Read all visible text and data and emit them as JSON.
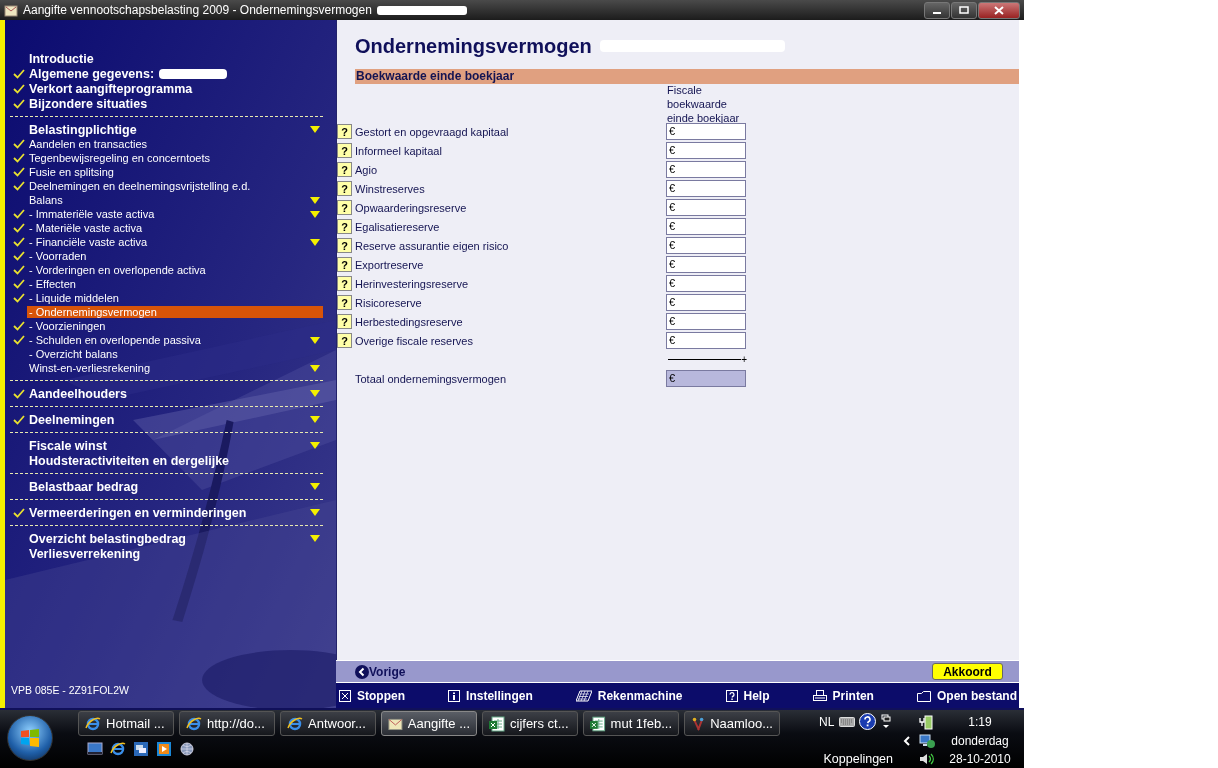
{
  "window": {
    "title": "Aangifte vennootschapsbelasting 2009 - Ondernemingsvermogen"
  },
  "sidebar": {
    "sections": [
      {
        "items": [
          {
            "kind": "heading",
            "label": "Introductie",
            "checked": false,
            "has_menu": false,
            "selected": false
          },
          {
            "kind": "heading",
            "label": "Algemene gegevens:",
            "checked": true,
            "has_menu": false,
            "selected": false
          },
          {
            "kind": "heading",
            "label": "Verkort aangifteprogramma",
            "checked": true,
            "has_menu": false,
            "selected": false
          },
          {
            "kind": "heading",
            "label": "Bijzondere situaties",
            "checked": true,
            "has_menu": false,
            "selected": false
          }
        ]
      },
      {
        "items": [
          {
            "kind": "heading",
            "label": "Belastingplichtige",
            "checked": false,
            "has_menu": true,
            "selected": false
          },
          {
            "kind": "item",
            "label": "Aandelen en transacties",
            "checked": true,
            "has_menu": false,
            "selected": false
          },
          {
            "kind": "item",
            "label": "Tegenbewijsregeling en concerntoets",
            "checked": true,
            "has_menu": false,
            "selected": false
          },
          {
            "kind": "item",
            "label": "Fusie en splitsing",
            "checked": true,
            "has_menu": false,
            "selected": false
          },
          {
            "kind": "item",
            "label": "Deelnemingen en deelnemingsvrijstelling e.d.",
            "checked": true,
            "has_menu": false,
            "selected": false
          },
          {
            "kind": "item",
            "label": "Balans",
            "checked": false,
            "has_menu": true,
            "selected": false
          },
          {
            "kind": "item",
            "label": "- Immateriële vaste activa",
            "checked": true,
            "has_menu": true,
            "selected": false
          },
          {
            "kind": "item",
            "label": "- Materiële vaste activa",
            "checked": true,
            "has_menu": false,
            "selected": false
          },
          {
            "kind": "item",
            "label": "- Financiële vaste activa",
            "checked": true,
            "has_menu": true,
            "selected": false
          },
          {
            "kind": "item",
            "label": "- Voorraden",
            "checked": true,
            "has_menu": false,
            "selected": false
          },
          {
            "kind": "item",
            "label": "- Vorderingen en overlopende activa",
            "checked": true,
            "has_menu": false,
            "selected": false
          },
          {
            "kind": "item",
            "label": "- Effecten",
            "checked": true,
            "has_menu": false,
            "selected": false
          },
          {
            "kind": "item",
            "label": "- Liquide middelen",
            "checked": true,
            "has_menu": false,
            "selected": false
          },
          {
            "kind": "item",
            "label": "- Ondernemingsvermogen",
            "checked": false,
            "has_menu": false,
            "selected": true
          },
          {
            "kind": "item",
            "label": "- Voorzieningen",
            "checked": true,
            "has_menu": false,
            "selected": false
          },
          {
            "kind": "item",
            "label": "- Schulden en overlopende passiva",
            "checked": true,
            "has_menu": true,
            "selected": false
          },
          {
            "kind": "item",
            "label": "- Overzicht balans",
            "checked": false,
            "has_menu": false,
            "selected": false
          },
          {
            "kind": "item",
            "label": "Winst-en-verliesrekening",
            "checked": false,
            "has_menu": true,
            "selected": false
          }
        ]
      },
      {
        "items": [
          {
            "kind": "heading",
            "label": "Aandeelhouders",
            "checked": true,
            "has_menu": true,
            "selected": false
          }
        ]
      },
      {
        "items": [
          {
            "kind": "heading",
            "label": "Deelnemingen",
            "checked": true,
            "has_menu": true,
            "selected": false
          }
        ]
      },
      {
        "items": [
          {
            "kind": "heading",
            "label": "Fiscale winst",
            "checked": false,
            "has_menu": true,
            "selected": false
          },
          {
            "kind": "heading",
            "label": "Houdsteractiviteiten en dergelijke",
            "checked": false,
            "has_menu": false,
            "selected": false
          }
        ]
      },
      {
        "items": [
          {
            "kind": "heading",
            "label": "Belastbaar bedrag",
            "checked": false,
            "has_menu": true,
            "selected": false
          }
        ]
      },
      {
        "items": [
          {
            "kind": "heading",
            "label": "Vermeerderingen en verminderingen",
            "checked": true,
            "has_menu": true,
            "selected": false
          }
        ]
      },
      {
        "items": [
          {
            "kind": "heading",
            "label": "Overzicht belastingbedrag",
            "checked": false,
            "has_menu": true,
            "selected": false
          },
          {
            "kind": "heading",
            "label": "Verliesverrekening",
            "checked": false,
            "has_menu": false,
            "selected": false
          }
        ]
      }
    ],
    "footer": "VPB 085E - 2Z91FOL2W"
  },
  "form": {
    "title": "Ondernemingsvermogen",
    "section": "Boekwaarde einde boekjaar",
    "column_header": "Fiscale boekwaarde einde boekjaar",
    "rows": [
      {
        "help": "?",
        "label": "Gestort en opgevraagd kapitaal",
        "value": "€"
      },
      {
        "help": "?",
        "label": "Informeel kapitaal",
        "value": "€"
      },
      {
        "help": "?",
        "label": "Agio",
        "value": "€"
      },
      {
        "help": "?",
        "label": "Winstreserves",
        "value": "€"
      },
      {
        "help": "?",
        "label": "Opwaarderingsreserve",
        "value": "€"
      },
      {
        "help": "?",
        "label": "Egalisatiereserve",
        "value": "€"
      },
      {
        "help": "?",
        "label": "Reserve assurantie eigen risico",
        "value": "€"
      },
      {
        "help": "?",
        "label": "Exportreserve",
        "value": "€"
      },
      {
        "help": "?",
        "label": "Herinvesteringsreserve",
        "value": "€"
      },
      {
        "help": "?",
        "label": "Risicoreserve",
        "value": "€"
      },
      {
        "help": "?",
        "label": "Herbestedingsreserve",
        "value": "€"
      },
      {
        "help": "?",
        "label": "Overige fiscale reserves",
        "value": "€"
      }
    ],
    "sum_sign": "+",
    "total": {
      "label": "Totaal ondernemingsvermogen",
      "value": "€"
    }
  },
  "action_bar": {
    "back": "Vorige",
    "confirm": "Akkoord"
  },
  "toolbar": [
    {
      "label": "Stoppen"
    },
    {
      "label": "Instellingen"
    },
    {
      "label": "Rekenmachine"
    },
    {
      "label": "Help"
    },
    {
      "label": "Printen"
    },
    {
      "label": "Open bestand"
    }
  ],
  "taskbar": {
    "tasks": [
      {
        "label": "Hotmail ...",
        "selected": false
      },
      {
        "label": "http://do...",
        "selected": false
      },
      {
        "label": "Antwoor...",
        "selected": false
      },
      {
        "label": "Aangifte ...",
        "selected": true
      },
      {
        "label": "cijfers ct...",
        "selected": false
      },
      {
        "label": "mut 1feb...",
        "selected": false
      },
      {
        "label": "Naamloo...",
        "selected": false
      }
    ],
    "language": "NL",
    "links": "Koppelingen",
    "time": "1:19",
    "day": "donderdag",
    "date": "28-10-2010"
  }
}
